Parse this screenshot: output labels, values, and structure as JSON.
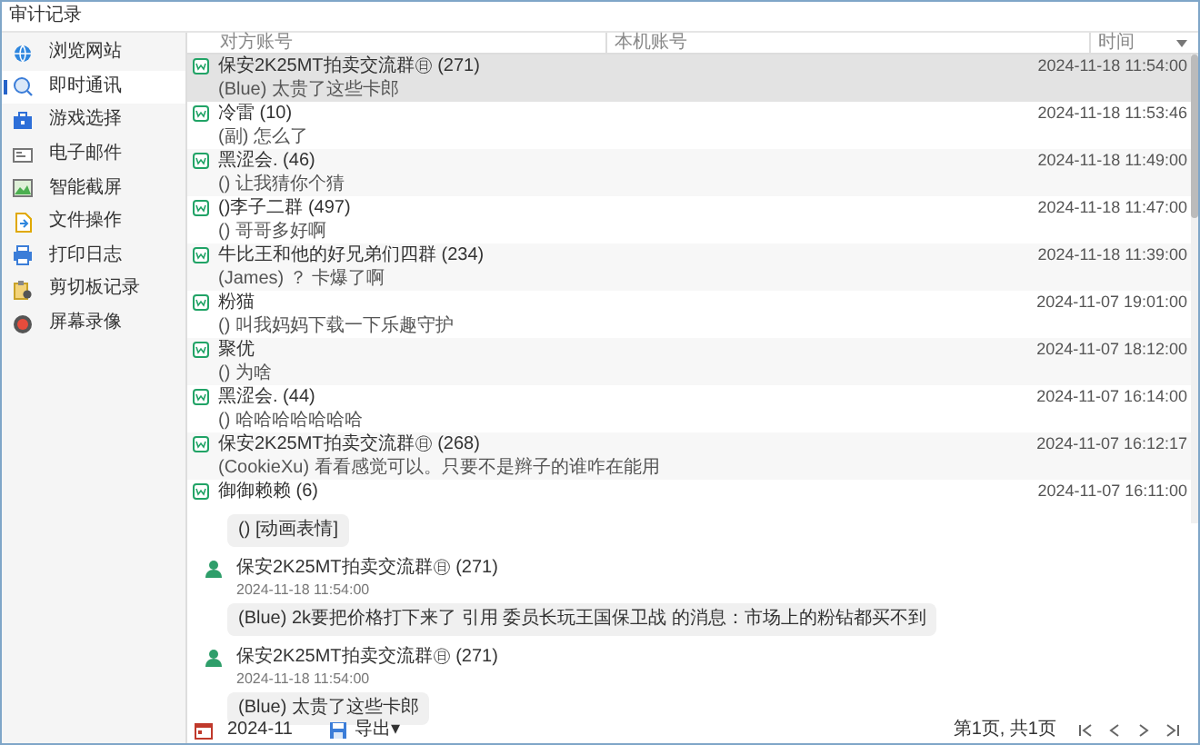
{
  "window": {
    "title": "审计记录"
  },
  "sidebar": {
    "items": [
      {
        "label": "浏览网站",
        "selected": false
      },
      {
        "label": "即时通讯",
        "selected": true
      },
      {
        "label": "游戏选择",
        "selected": false
      },
      {
        "label": "电子邮件",
        "selected": false
      },
      {
        "label": "智能截屏",
        "selected": false
      },
      {
        "label": "文件操作",
        "selected": false
      },
      {
        "label": "打印日志",
        "selected": false
      },
      {
        "label": "剪切板记录",
        "selected": false
      },
      {
        "label": "屏幕录像",
        "selected": false
      }
    ]
  },
  "table": {
    "columns": [
      "对方账号",
      "本机账号",
      "时间"
    ],
    "rows": [
      {
        "name": "保安2K25MT拍卖交流群㊐ (271)",
        "preview": "(Blue) 太贵了这些卡郎",
        "time": "2024-11-18 11:54:00",
        "selected": true
      },
      {
        "name": "冷雷 (10)",
        "preview": "(副) 怎么了",
        "time": "2024-11-18 11:53:46",
        "selected": false
      },
      {
        "name": "黑涩会. (46)",
        "preview": "() 让我猜你个猜",
        "time": "2024-11-18 11:49:00",
        "selected": false
      },
      {
        "name": "()李子二群 (497)",
        "preview": "() 哥哥多好啊",
        "time": "2024-11-18 11:47:00",
        "selected": false
      },
      {
        "name": "牛比王和他的好兄弟们四群 (234)",
        "preview": "(James) ？ 卡爆了啊",
        "time": "2024-11-18 11:39:00",
        "selected": false
      },
      {
        "name": "粉猫",
        "preview": "() 叫我妈妈下载一下乐趣守护",
        "time": "2024-11-07 19:01:00",
        "selected": false
      },
      {
        "name": "聚优",
        "preview": "() 为啥",
        "time": "2024-11-07 18:12:00",
        "selected": false
      },
      {
        "name": "黑涩会. (44)",
        "preview": "() 哈哈哈哈哈哈哈",
        "time": "2024-11-07 16:14:00",
        "selected": false
      },
      {
        "name": "保安2K25MT拍卖交流群㊐ (268)",
        "preview": "(CookieXu) 看看感觉可以。只要不是辫子的谁咋在能用",
        "time": "2024-11-07 16:12:17",
        "selected": false
      },
      {
        "name": "御御赖赖 (6)",
        "time": "2024-11-07 16:11:00",
        "selected": false
      }
    ]
  },
  "detail": {
    "messages": [
      {
        "kind": "bubble",
        "text": "() [动画表情]"
      },
      {
        "kind": "message",
        "sender": "保安2K25MT拍卖交流群㊐ (271)",
        "time": "2024-11-18 11:54:00",
        "text": "(Blue) 2k要把价格打下来了 引用 委员长玩王国保卫战 的消息：市场上的粉钻都买不到"
      },
      {
        "kind": "message",
        "sender": "保安2K25MT拍卖交流群㊐ (271)",
        "time": "2024-11-18 11:54:00",
        "text": "(Blue) 太贵了这些卡郎"
      }
    ]
  },
  "footer": {
    "month": "2024-11",
    "export": "导出▾",
    "page": "第1页, 共1页"
  }
}
